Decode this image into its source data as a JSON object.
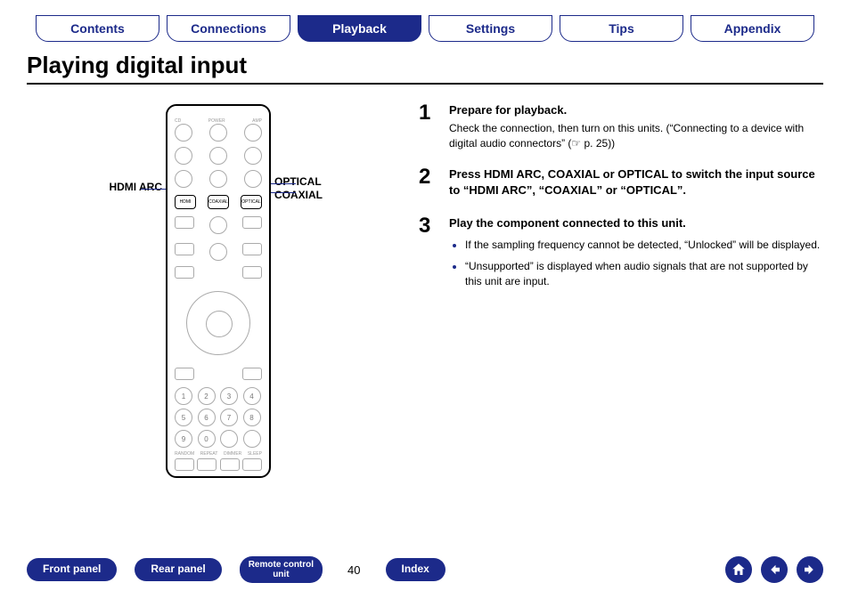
{
  "tabs": {
    "items": [
      {
        "label": "Contents",
        "active": false
      },
      {
        "label": "Connections",
        "active": false
      },
      {
        "label": "Playback",
        "active": true
      },
      {
        "label": "Settings",
        "active": false
      },
      {
        "label": "Tips",
        "active": false
      },
      {
        "label": "Appendix",
        "active": false
      }
    ]
  },
  "title": "Playing digital input",
  "remote": {
    "left_callout": "HDMI ARC",
    "right_callout_1": "OPTICAL",
    "right_callout_2": "COAXIAL",
    "input_labels": [
      "HDMI",
      "COAXIAL",
      "OPTICAL"
    ]
  },
  "steps": [
    {
      "num": "1",
      "title": "Prepare for playback.",
      "body": "Check the connection, then turn on this units. (“Connecting to a device with digital audio connectors” (☞ p. 25))"
    },
    {
      "num": "2",
      "title": "Press HDMI ARC, COAXIAL or OPTICAL to switch the input source to “HDMI ARC”, “COAXIAL” or “OPTICAL”.",
      "body": ""
    },
    {
      "num": "3",
      "title": "Play the component connected to this unit.",
      "bullets": [
        "If the sampling frequency cannot be detected, “Unlocked” will be displayed.",
        "“Unsupported” is displayed when audio signals that are not supported by this unit are input."
      ]
    }
  ],
  "footer": {
    "buttons": [
      {
        "label": "Front panel"
      },
      {
        "label": "Rear panel"
      },
      {
        "label": "Remote control\nunit",
        "multiline": true
      }
    ],
    "page": "40",
    "index": "Index",
    "icons": [
      "home",
      "prev",
      "next"
    ]
  }
}
